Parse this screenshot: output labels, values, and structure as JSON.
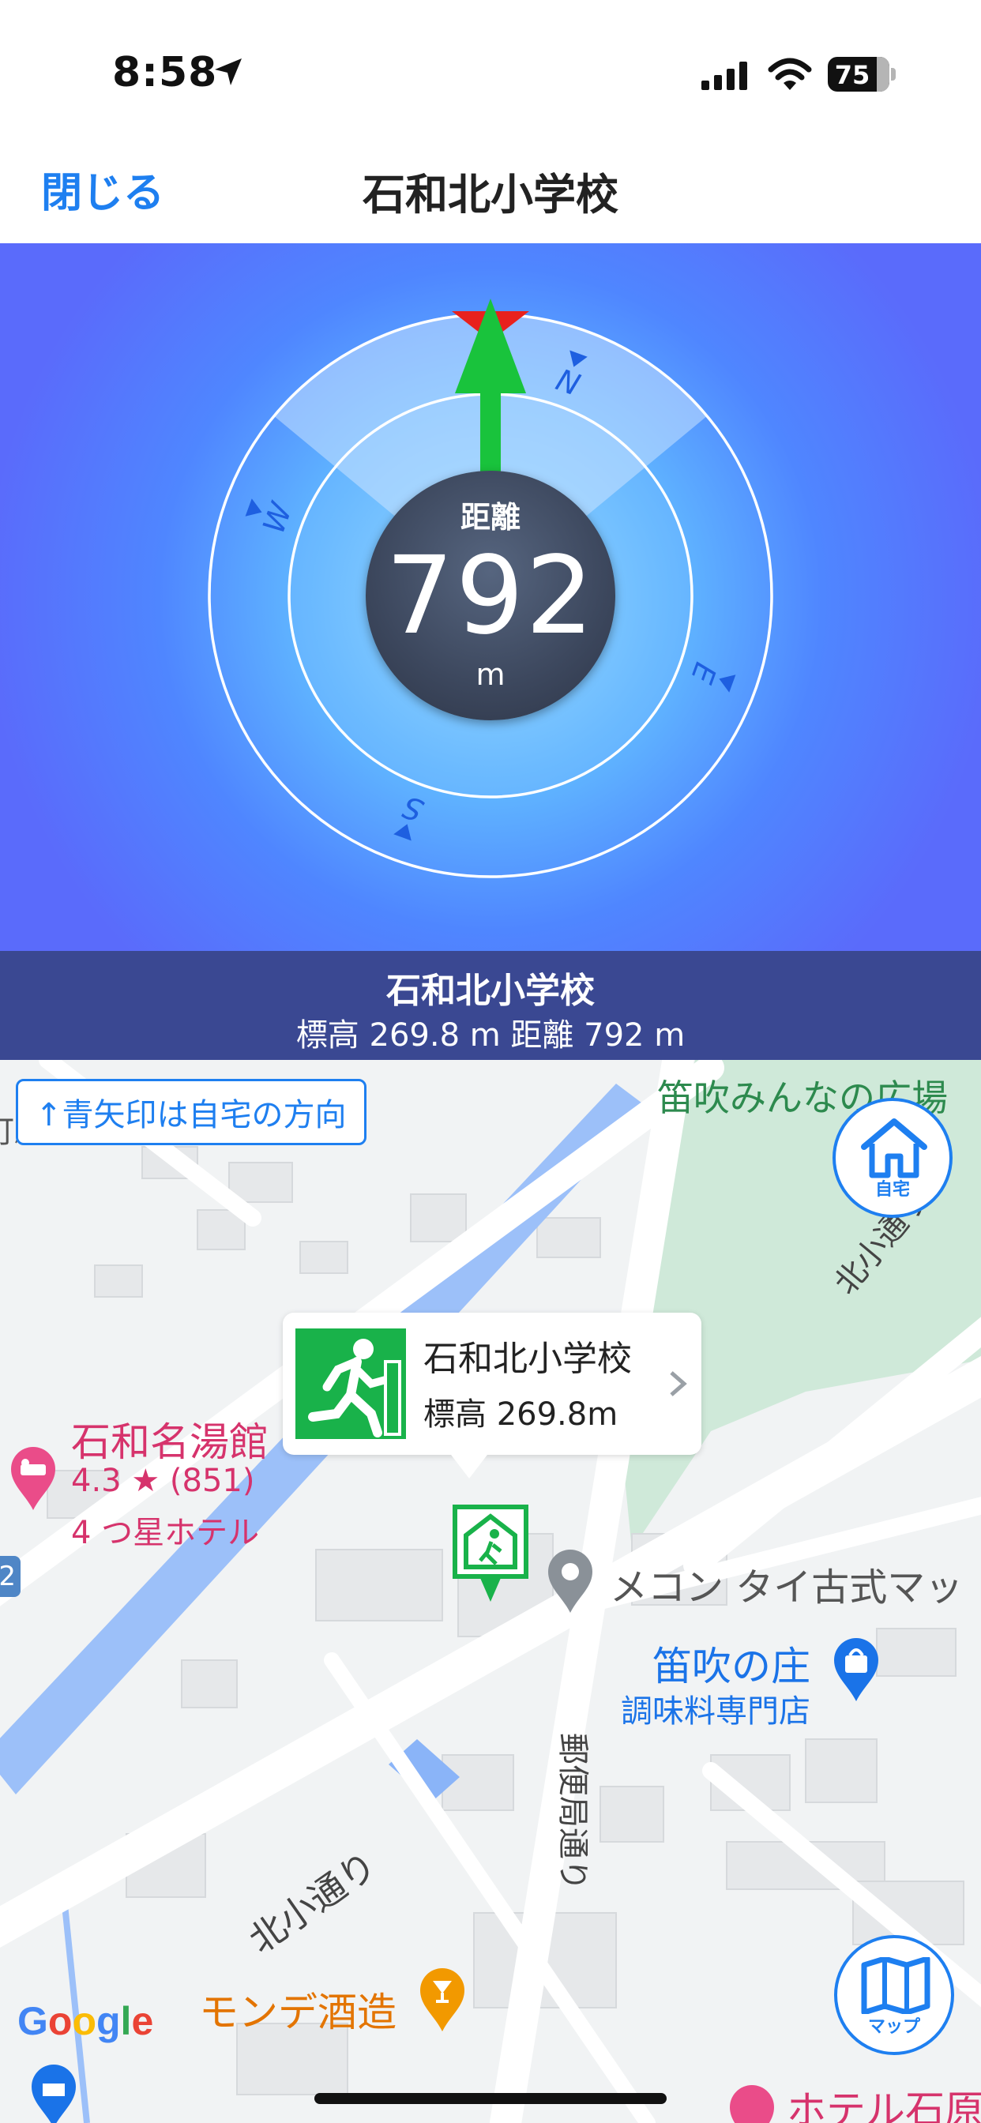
{
  "status_bar": {
    "time": "8:58",
    "battery": "75"
  },
  "nav": {
    "close_label": "閉じる",
    "title": "石和北小学校"
  },
  "compass": {
    "distance_label": "距離",
    "distance_value": "792",
    "distance_unit": "m",
    "directions": [
      "N",
      "E",
      "S",
      "W"
    ],
    "colors": {
      "arrow": "#19c33c",
      "marker": "#e8211d",
      "accent": "#1e5fe0"
    }
  },
  "info": {
    "title": "石和北小学校",
    "subtitle": "標高 269.8 m  距離 792 m"
  },
  "map": {
    "hint": "↑青矢印は自宅の方向",
    "home_button_label": "自宅",
    "map_button_label": "マップ",
    "callout": {
      "name": "石和北小学校",
      "elevation": "標高 269.8m"
    },
    "pois": {
      "park": "笛吹みんなの広場",
      "station_fragment": "町駅前",
      "hotel_name": "石和名湯館",
      "hotel_rating": "4.3 ★ (851)",
      "hotel_type": "4 つ星ホテル",
      "thai": "メコン タイ古式マッ",
      "shop_name": "笛吹の庄",
      "shop_type": "調味料専門店",
      "brewery": "モンデ酒造",
      "hotel2": "ホテル石原",
      "road1": "北小通り",
      "road2": "北小通り",
      "road3": "郵便局通り",
      "badge": "2"
    },
    "attribution": "Google"
  }
}
